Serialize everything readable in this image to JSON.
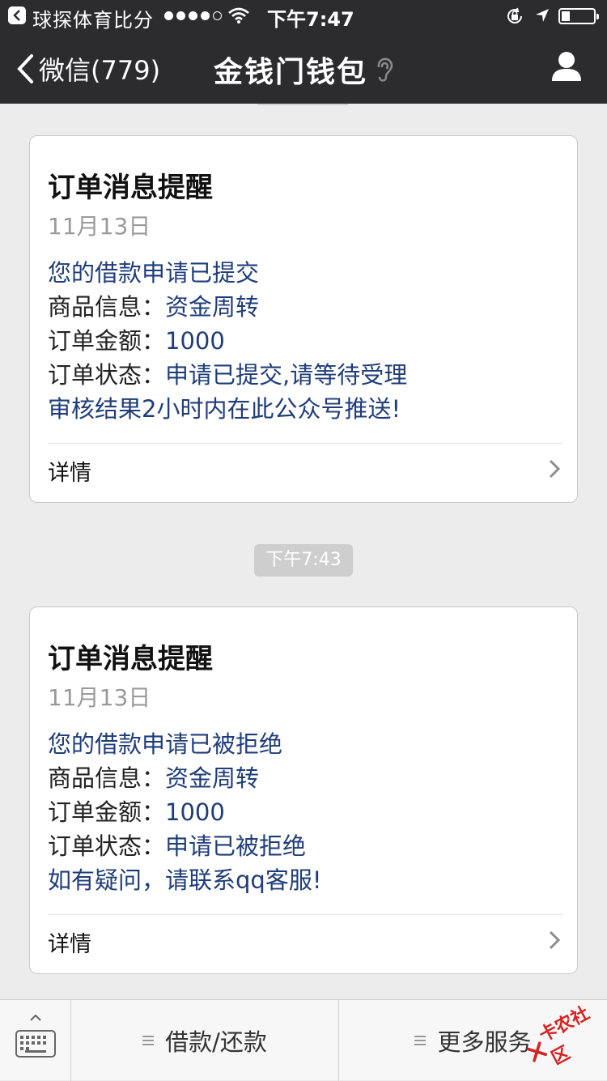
{
  "status_bar": {
    "app_name": "球探体育比分",
    "time": "下午7:47"
  },
  "nav": {
    "back_label": "微信(779)",
    "title": "金钱门钱包"
  },
  "messages": [
    {
      "title": "订单消息提醒",
      "date": "11月13日",
      "headline": "您的借款申请已提交",
      "product_label": "商品信息：",
      "product_value": "资金周转",
      "amount_label": "订单金额：",
      "amount_value": "1000",
      "status_label": "订单状态：",
      "status_value": "申请已提交,请等待受理",
      "note": "审核结果2小时内在此公众号推送!",
      "detail_label": "详情"
    },
    {
      "title": "订单消息提醒",
      "date": "11月13日",
      "headline": "您的借款申请已被拒绝",
      "product_label": "商品信息：",
      "product_value": "资金周转",
      "amount_label": "订单金额：",
      "amount_value": "1000",
      "status_label": "订单状态：",
      "status_value": "申请已被拒绝",
      "note": "如有疑问，请联系qq客服!",
      "detail_label": "详情"
    }
  ],
  "timestamp_pill": "下午7:43",
  "bottom_menu": {
    "item1": "借款/还款",
    "item2": "更多服务"
  },
  "watermark": {
    "text": "卡农社区",
    "color": "#d62222"
  },
  "colors": {
    "nav_bg": "#2c2c2e",
    "chat_bg": "#ececec",
    "accent_blue": "#1f3d7a"
  }
}
